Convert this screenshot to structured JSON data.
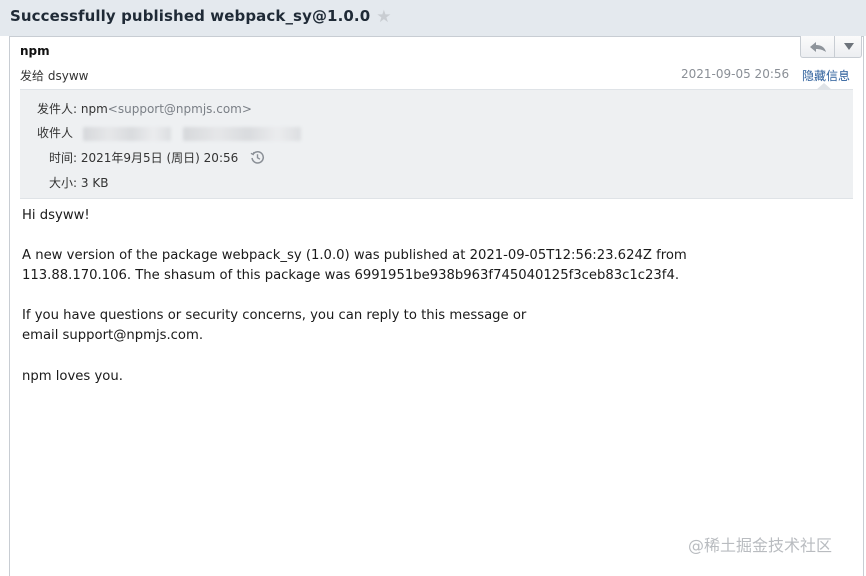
{
  "subject": {
    "title": "Successfully published webpack_sy@1.0.0",
    "star_icon": "star-icon"
  },
  "header": {
    "sender_name": "npm",
    "sent_to_label": "发给",
    "sent_to_name": "dsyww",
    "date": "2021-09-05 20:56",
    "hide_details_link": "隐藏信息",
    "reply_icon": "reply-arrow-icon",
    "more_icon": "chevron-down-icon"
  },
  "details": {
    "from_label": "发件人:",
    "from_name": "npm",
    "from_address": "<support@npmjs.com>",
    "to_label": "收件人",
    "time_label": "时间:",
    "time_value": "2021年9月5日 (周日) 20:56",
    "size_label": "大小:",
    "size_value": "3 KB"
  },
  "body": {
    "greeting": "Hi dsyww!",
    "para1_line1": "A new version of the package webpack_sy (1.0.0) was published at 2021-09-05T12:56:23.624Z from",
    "para1_line2": "113.88.170.106. The shasum of this package was 6991951be938b963f745040125f3ceb83c1c23f4.",
    "para2_line1": "If you have questions or security concerns, you can reply to this message or",
    "para2_line2": "email support@npmjs.com.",
    "signoff": "npm loves you."
  },
  "watermark": "@稀土掘金技术社区",
  "colors": {
    "title_bar": "#e4e9ee",
    "details_bg": "#eef0f2",
    "link": "#2a5d9a"
  }
}
